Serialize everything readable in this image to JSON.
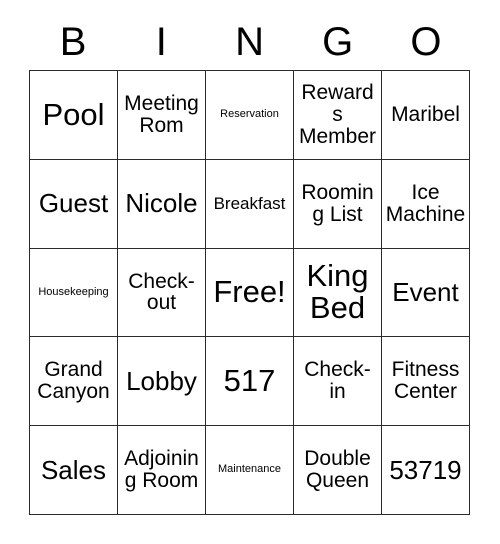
{
  "card": {
    "title": "BINGO",
    "header_letters": [
      "B",
      "I",
      "N",
      "G",
      "O"
    ],
    "grid_size": "5x5",
    "free_space": "Free!",
    "colors": {
      "background": "#ffffff",
      "cell_background": "#ffffff",
      "border": "#2b2b2b",
      "text": "#000000"
    },
    "rows": [
      [
        {
          "text": "Pool",
          "size": "xl"
        },
        {
          "text": "Meeting Rom",
          "size": "md"
        },
        {
          "text": "Reservation",
          "size": "xs"
        },
        {
          "text": "Rewards Member",
          "size": "md"
        },
        {
          "text": "Maribel",
          "size": "md"
        }
      ],
      [
        {
          "text": "Guest",
          "size": "lg"
        },
        {
          "text": "Nicole",
          "size": "lg"
        },
        {
          "text": "Breakfast",
          "size": "sm"
        },
        {
          "text": "Rooming List",
          "size": "md"
        },
        {
          "text": "Ice Machine",
          "size": "md"
        }
      ],
      [
        {
          "text": "Housekeeping",
          "size": "xs"
        },
        {
          "text": "Check-out",
          "size": "md"
        },
        {
          "text": "Free!",
          "size": "xl"
        },
        {
          "text": "King Bed",
          "size": "xl"
        },
        {
          "text": "Event",
          "size": "lg"
        }
      ],
      [
        {
          "text": "Grand Canyon",
          "size": "md"
        },
        {
          "text": "Lobby",
          "size": "lg"
        },
        {
          "text": "517",
          "size": "xl"
        },
        {
          "text": "Check-in",
          "size": "md"
        },
        {
          "text": "Fitness Center",
          "size": "md"
        }
      ],
      [
        {
          "text": "Sales",
          "size": "lg"
        },
        {
          "text": "Adjoining Room",
          "size": "md"
        },
        {
          "text": "Maintenance",
          "size": "xs"
        },
        {
          "text": "Double Queen",
          "size": "md"
        },
        {
          "text": "53719",
          "size": "lg"
        }
      ]
    ]
  }
}
